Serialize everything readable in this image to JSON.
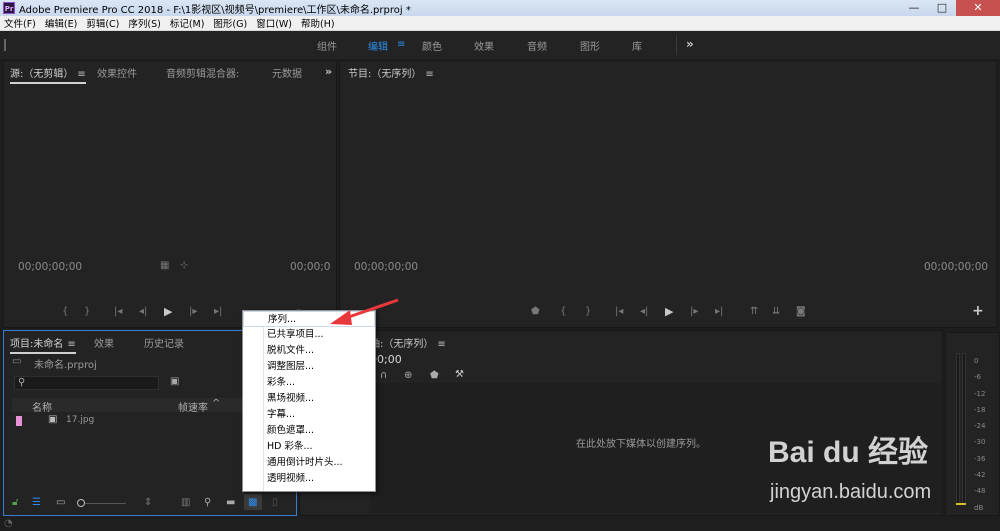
{
  "window": {
    "title": "Adobe Premiere Pro CC 2018 - F:\\1影视区\\视频号\\premiere\\工作区\\未命名.prproj *",
    "app_icon": "Pr",
    "minimize": "—",
    "maximize": "□",
    "close": "✕"
  },
  "menubar": [
    "文件(F)",
    "编辑(E)",
    "剪辑(C)",
    "序列(S)",
    "标记(M)",
    "图形(G)",
    "窗口(W)",
    "帮助(H)"
  ],
  "workspaces": {
    "tabs": [
      "组件",
      "编辑",
      "颜色",
      "效果",
      "音频",
      "图形",
      "库"
    ],
    "active": "编辑",
    "menu_glyph": "≡",
    "more": "»"
  },
  "source_panel": {
    "tabs": [
      "源:（无剪辑）",
      "效果控件",
      "音频剪辑混合器:",
      "元数据"
    ],
    "menu_glyph": "≡",
    "more": "»",
    "timecode_left": "00;00;00;00",
    "timecode_right": "00;00;0"
  },
  "program_panel": {
    "tab": "节目:（无序列）",
    "menu_glyph": "≡",
    "timecode_left": "00;00;00;00",
    "timecode_right": "00;00;00;00",
    "add": "+"
  },
  "project_panel": {
    "tabs": [
      "项目:未命名",
      "效果",
      "历史记录"
    ],
    "menu_glyph": "≡",
    "file_name": "未命名.prproj",
    "columns": [
      "名称",
      "帧速率"
    ],
    "items": [
      {
        "name": "17.jpg"
      }
    ]
  },
  "timeline_panel": {
    "tab": "时间轴:（无序列）",
    "tab_visible": "轴:（无序列）",
    "menu_glyph": "≡",
    "timecode": "00;00",
    "drop_hint": "在此处放下媒体以创建序列。"
  },
  "context_menu": {
    "items": [
      "序列...",
      "已共享项目...",
      "脱机文件...",
      "调整图层...",
      "彩条...",
      "黑场视频...",
      "字幕...",
      "颜色遮罩...",
      "HD 彩条...",
      "通用倒计时片头...",
      "透明视频..."
    ],
    "hover_index": 0
  },
  "audio_meter": {
    "scale": [
      "0",
      "-6",
      "-12",
      "-18",
      "-24",
      "-30",
      "-36",
      "-42",
      "-48",
      "dB"
    ]
  },
  "watermark": {
    "brand": "Bai du 经验",
    "url": "jingyan.baidu.com"
  },
  "colors": {
    "accent": "#2d8ceb",
    "arrow": "#e8383d"
  }
}
